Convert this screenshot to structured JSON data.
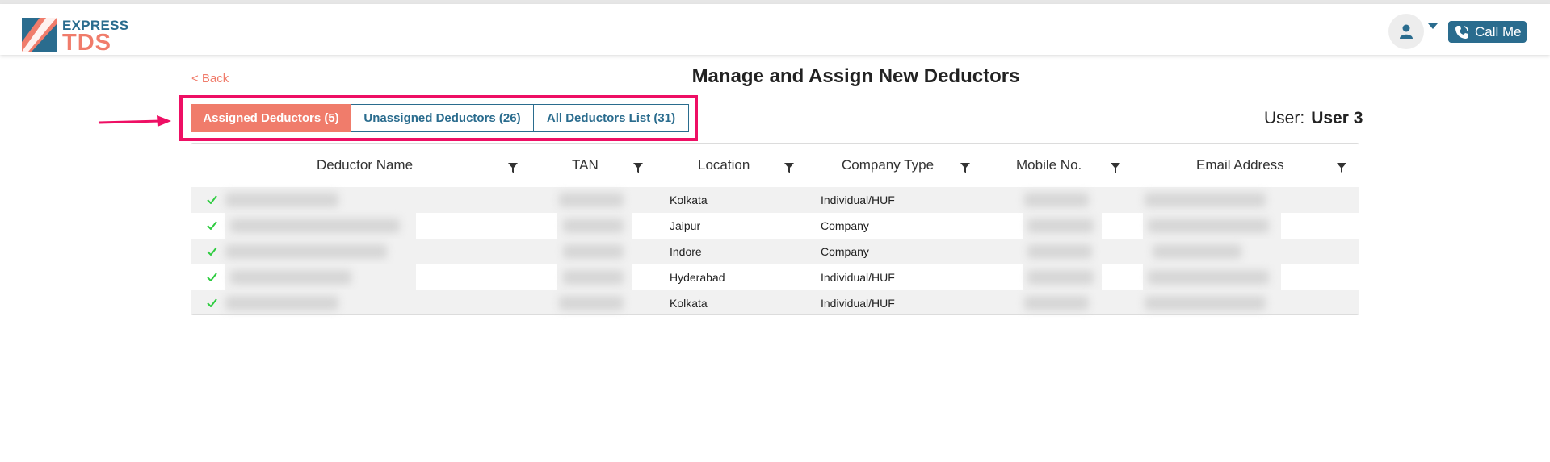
{
  "brand": {
    "line1": "EXPRESS",
    "line2": "TDS"
  },
  "header": {
    "call_label": "Call Me"
  },
  "nav": {
    "back_label": "< Back"
  },
  "page": {
    "title": "Manage and Assign New Deductors"
  },
  "tabs": [
    {
      "label": "Assigned Deductors (5)",
      "active": true
    },
    {
      "label": "Unassigned Deductors (26)",
      "active": false
    },
    {
      "label": "All Deductors List (31)",
      "active": false
    }
  ],
  "user": {
    "label": "User:",
    "name": "User 3"
  },
  "table": {
    "columns": [
      "Deductor Name",
      "TAN",
      "Location",
      "Company Type",
      "Mobile No.",
      "Email Address"
    ],
    "rows": [
      {
        "location": "Kolkata",
        "company_type": "Individual/HUF"
      },
      {
        "location": "Jaipur",
        "company_type": "Company"
      },
      {
        "location": "Indore",
        "company_type": "Company"
      },
      {
        "location": "Hyderabad",
        "company_type": "Individual/HUF"
      },
      {
        "location": "Kolkata",
        "company_type": "Individual/HUF"
      }
    ]
  },
  "colors": {
    "brand_blue": "#2a6c8e",
    "brand_coral": "#f07c6b",
    "highlight": "#ee0f64",
    "check": "#2ecc40"
  }
}
